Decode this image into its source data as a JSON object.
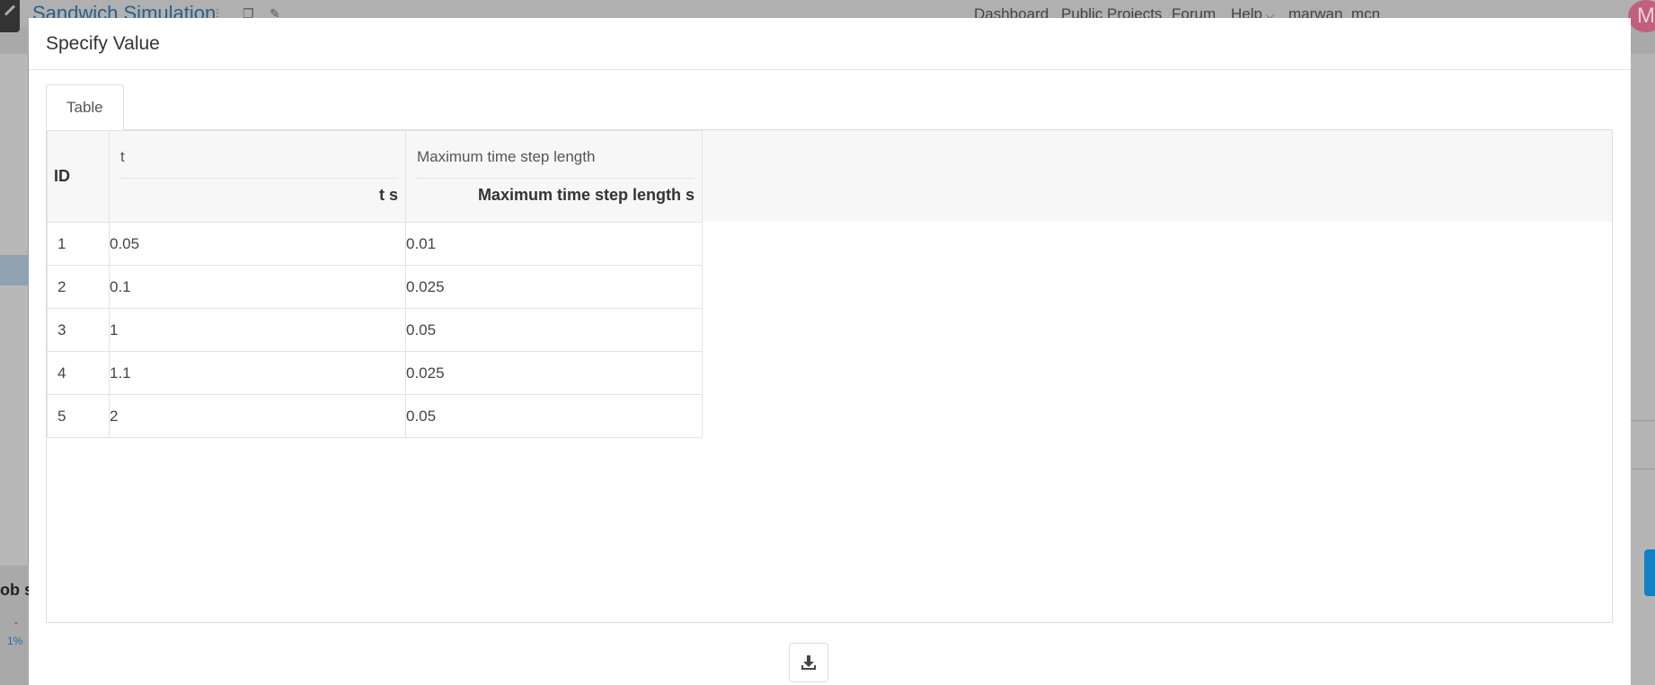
{
  "background": {
    "app_title": "Sandwich Simulation",
    "nav": [
      "Dashboard",
      "Public Projects",
      "Forum",
      "Help"
    ],
    "help_chevron": "chevron-down-icon",
    "username": "marwan_mcn",
    "avatar_letter": "M",
    "side_text": "ob s",
    "side_dash": "-",
    "side_progress": "1%",
    "toolbar_icons": [
      "share-icon",
      "copy-icon",
      "edit-icon"
    ]
  },
  "modal": {
    "title": "Specify Value",
    "tabs": [
      {
        "label": "Table",
        "active": true
      }
    ],
    "table": {
      "id_header": "ID",
      "columns": [
        {
          "name": "t",
          "label": "t s"
        },
        {
          "name": "Maximum time step length",
          "label": "Maximum time step length s"
        }
      ],
      "rows": [
        {
          "id": "1",
          "t": "0.05",
          "max_dt": "0.01"
        },
        {
          "id": "2",
          "t": "0.1",
          "max_dt": "0.025"
        },
        {
          "id": "3",
          "t": "1",
          "max_dt": "0.05"
        },
        {
          "id": "4",
          "t": "1.1",
          "max_dt": "0.025"
        },
        {
          "id": "5",
          "t": "2",
          "max_dt": "0.05"
        }
      ]
    },
    "download_icon": "download-icon"
  }
}
